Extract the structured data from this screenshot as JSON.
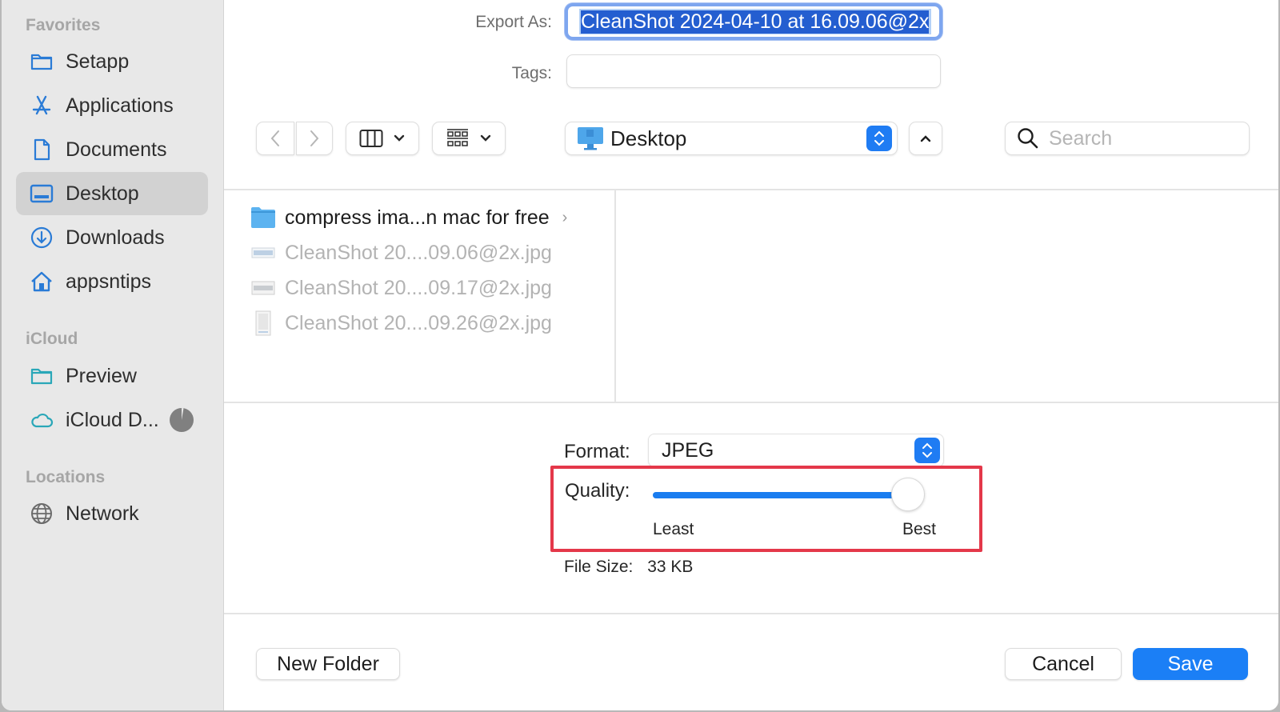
{
  "sidebar": {
    "sections": [
      {
        "label": "Favorites"
      },
      {
        "label": "iCloud"
      },
      {
        "label": "Locations"
      }
    ],
    "items": [
      {
        "label": "Setapp",
        "icon": "folder-icon",
        "section": "Favorites"
      },
      {
        "label": "Applications",
        "icon": "applications-icon",
        "section": "Favorites"
      },
      {
        "label": "Documents",
        "icon": "document-icon",
        "section": "Favorites"
      },
      {
        "label": "Desktop",
        "icon": "desktop-icon",
        "section": "Favorites",
        "selected": true
      },
      {
        "label": "Downloads",
        "icon": "download-icon",
        "section": "Favorites"
      },
      {
        "label": "appsntips",
        "icon": "home-icon",
        "section": "Favorites"
      },
      {
        "label": "Preview",
        "icon": "folder-icon",
        "section": "iCloud"
      },
      {
        "label": "iCloud D...",
        "icon": "cloud-icon",
        "section": "iCloud",
        "status": "sync-progress-icon"
      },
      {
        "label": "Network",
        "icon": "globe-icon",
        "section": "Locations"
      }
    ]
  },
  "header": {
    "export_as_label": "Export As:",
    "export_as_value": "CleanShot 2024-04-10 at 16.09.06@2x",
    "tags_label": "Tags:",
    "tags_value": ""
  },
  "toolbar": {
    "back_icon": "chevron-left-icon",
    "forward_icon": "chevron-right-icon",
    "view_mode_icon": "column-view-icon",
    "group_icon": "grid-group-icon",
    "location": "Desktop",
    "location_icon": "desktop-computer-icon",
    "search_placeholder": "Search"
  },
  "browser": {
    "files": [
      {
        "name": "compress ima...n mac for free",
        "type": "folder",
        "enabled": true
      },
      {
        "name": "CleanShot 20....09.06@2x.jpg",
        "type": "image",
        "enabled": false
      },
      {
        "name": "CleanShot 20....09.17@2x.jpg",
        "type": "image",
        "enabled": false
      },
      {
        "name": "CleanShot 20....09.26@2x.jpg",
        "type": "image-portrait",
        "enabled": false
      }
    ]
  },
  "options": {
    "format_label": "Format:",
    "format_value": "JPEG",
    "quality_label": "Quality:",
    "quality_value": 1.0,
    "quality_min_label": "Least",
    "quality_max_label": "Best",
    "file_size_label": "File Size:",
    "file_size_value": "33 KB",
    "highlight_color": "#e4384a"
  },
  "footer": {
    "new_folder_label": "New Folder",
    "cancel_label": "Cancel",
    "save_label": "Save"
  },
  "colors": {
    "accent": "#1b7ff6",
    "sidebar_bg": "#e8e8e8",
    "selected_bg": "#d2d2d2"
  }
}
